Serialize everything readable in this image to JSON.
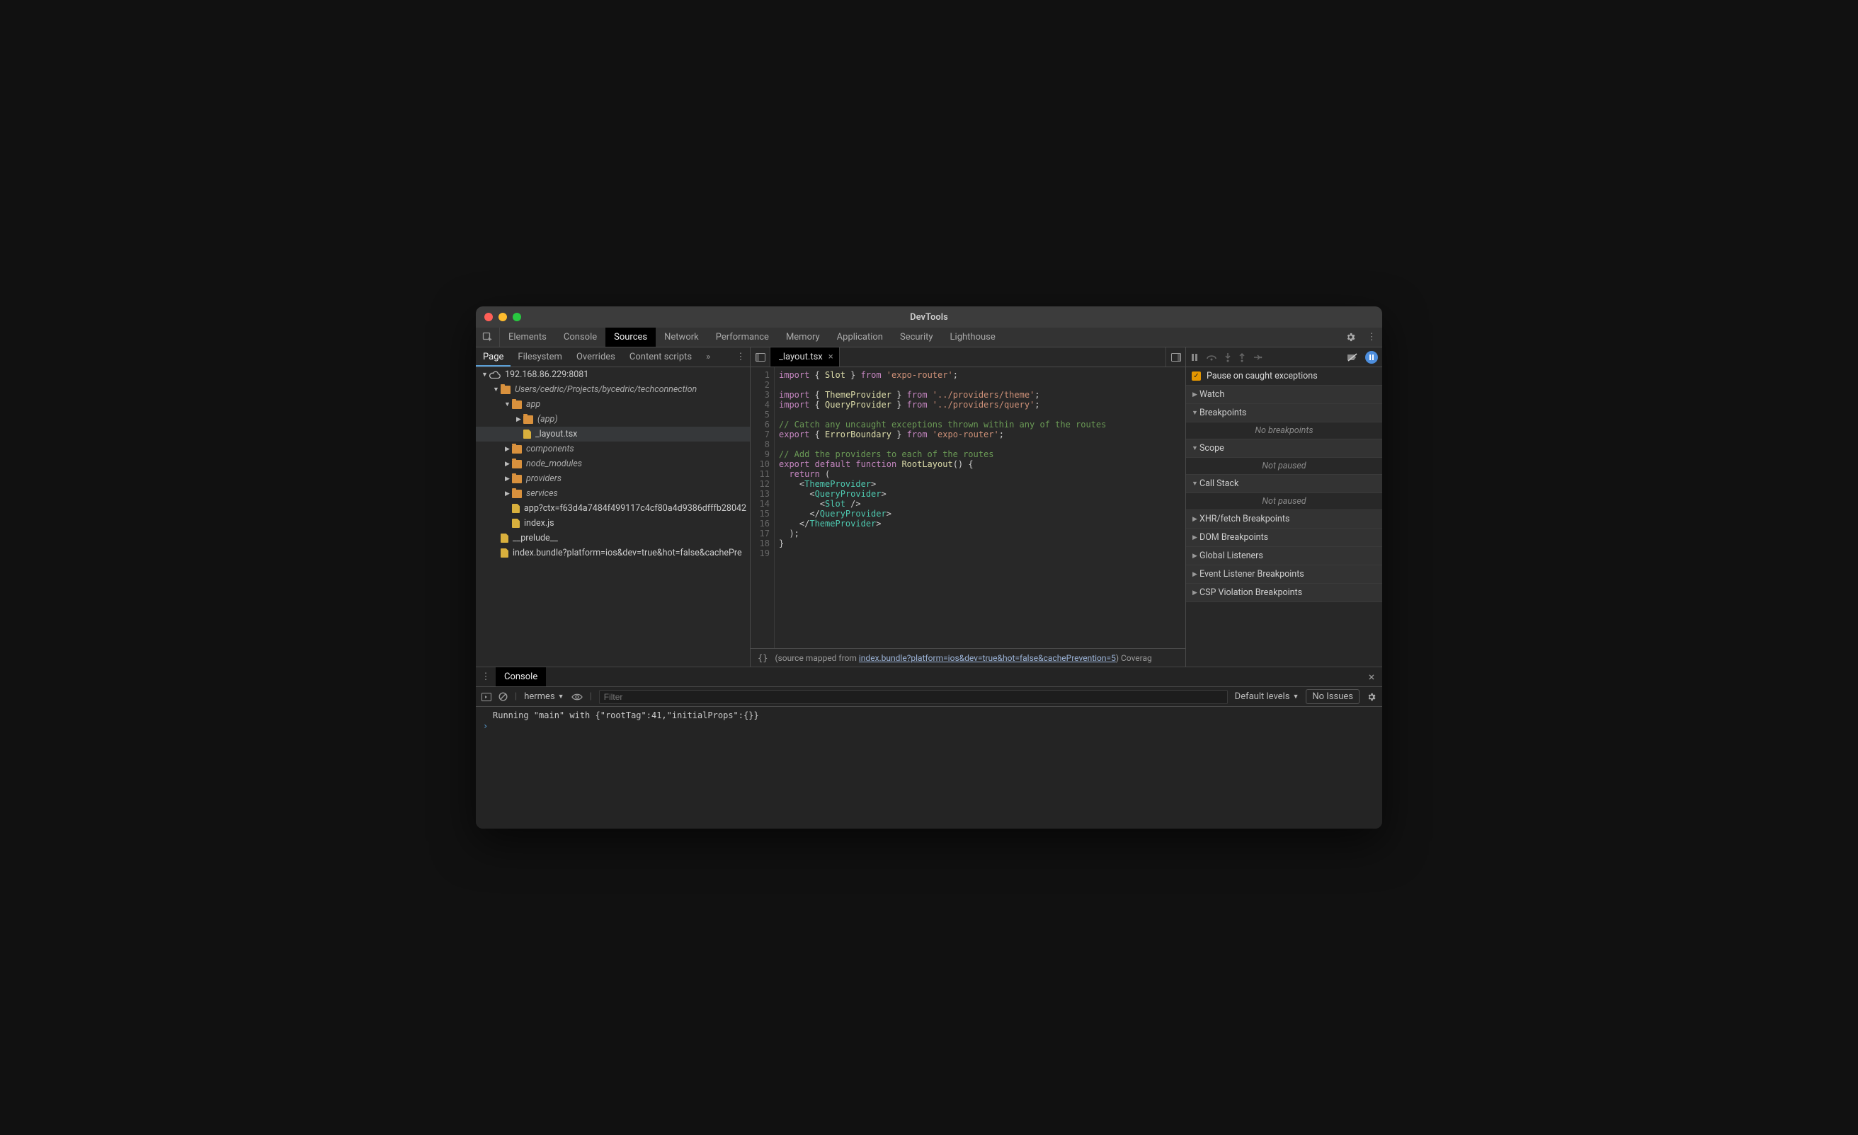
{
  "window": {
    "title": "DevTools"
  },
  "mainTabs": [
    "Elements",
    "Console",
    "Sources",
    "Network",
    "Performance",
    "Memory",
    "Application",
    "Security",
    "Lighthouse"
  ],
  "mainTabActive": "Sources",
  "navTabs": [
    "Page",
    "Filesystem",
    "Overrides",
    "Content scripts"
  ],
  "navTabActive": "Page",
  "tree": {
    "root": "192.168.86.229:8081",
    "rootPath": "Users/cedric/Projects/bycedric/techconnection",
    "app": "app",
    "appSub": "(app)",
    "selectedFile": "_layout.tsx",
    "folders": [
      "components",
      "node_modules",
      "providers",
      "services"
    ],
    "filesAfter": [
      "app?ctx=f63d4a7484f499117c4cf80a4d9386dfffb28042",
      "index.js"
    ],
    "prelude": "__prelude__",
    "bundle": "index.bundle?platform=ios&dev=true&hot=false&cachePre"
  },
  "editor": {
    "tab": "_layout.tsx",
    "lines": [
      [
        [
          "imp",
          "import"
        ],
        [
          "p",
          " { "
        ],
        [
          "id",
          "Slot"
        ],
        [
          "p",
          " } "
        ],
        [
          "imp",
          "from"
        ],
        [
          "p",
          " "
        ],
        [
          "str",
          "'expo-router'"
        ],
        [
          "p",
          ";"
        ]
      ],
      [],
      [
        [
          "imp",
          "import"
        ],
        [
          "p",
          " { "
        ],
        [
          "id",
          "ThemeProvider"
        ],
        [
          "p",
          " } "
        ],
        [
          "imp",
          "from"
        ],
        [
          "p",
          " "
        ],
        [
          "str",
          "'../providers/theme'"
        ],
        [
          "p",
          ";"
        ]
      ],
      [
        [
          "imp",
          "import"
        ],
        [
          "p",
          " { "
        ],
        [
          "id",
          "QueryProvider"
        ],
        [
          "p",
          " } "
        ],
        [
          "imp",
          "from"
        ],
        [
          "p",
          " "
        ],
        [
          "str",
          "'../providers/query'"
        ],
        [
          "p",
          ";"
        ]
      ],
      [],
      [
        [
          "cmt",
          "// Catch any uncaught exceptions thrown within any of the routes"
        ]
      ],
      [
        [
          "imp",
          "export"
        ],
        [
          "p",
          " { "
        ],
        [
          "id",
          "ErrorBoundary"
        ],
        [
          "p",
          " } "
        ],
        [
          "imp",
          "from"
        ],
        [
          "p",
          " "
        ],
        [
          "str",
          "'expo-router'"
        ],
        [
          "p",
          ";"
        ]
      ],
      [],
      [
        [
          "cmt",
          "// Add the providers to each of the routes"
        ]
      ],
      [
        [
          "imp",
          "export"
        ],
        [
          "p",
          " "
        ],
        [
          "imp",
          "default"
        ],
        [
          "p",
          " "
        ],
        [
          "imp",
          "function"
        ],
        [
          "p",
          " "
        ],
        [
          "id",
          "RootLayout"
        ],
        [
          "p",
          "() {"
        ]
      ],
      [
        [
          "p",
          "  "
        ],
        [
          "imp",
          "return"
        ],
        [
          "p",
          " ("
        ]
      ],
      [
        [
          "p",
          "    <"
        ],
        [
          "jsx",
          "ThemeProvider"
        ],
        [
          "p",
          ">"
        ]
      ],
      [
        [
          "p",
          "      <"
        ],
        [
          "jsx",
          "QueryProvider"
        ],
        [
          "p",
          ">"
        ]
      ],
      [
        [
          "p",
          "        <"
        ],
        [
          "jsx",
          "Slot"
        ],
        [
          "p",
          " />"
        ]
      ],
      [
        [
          "p",
          "      </"
        ],
        [
          "jsx",
          "QueryProvider"
        ],
        [
          "p",
          ">"
        ]
      ],
      [
        [
          "p",
          "    </"
        ],
        [
          "jsx",
          "ThemeProvider"
        ],
        [
          "p",
          ">"
        ]
      ],
      [
        [
          "p",
          "  );"
        ]
      ],
      [
        [
          "p",
          "}"
        ]
      ],
      []
    ],
    "statusPrefix": "(source mapped from ",
    "statusLink": "index.bundle?platform=ios&dev=true&hot=false&cachePrevention=5",
    "statusSuffix": ")  Coverag"
  },
  "debugger": {
    "pauseCaught": "Pause on caught exceptions",
    "sections": {
      "watch": "Watch",
      "breakpoints": "Breakpoints",
      "breakpointsBody": "No breakpoints",
      "scope": "Scope",
      "scopeBody": "Not paused",
      "callStack": "Call Stack",
      "callStackBody": "Not paused",
      "xhr": "XHR/fetch Breakpoints",
      "dom": "DOM Breakpoints",
      "global": "Global Listeners",
      "event": "Event Listener Breakpoints",
      "csp": "CSP Violation Breakpoints"
    }
  },
  "console": {
    "tab": "Console",
    "context": "hermes",
    "filterPlaceholder": "Filter",
    "levels": "Default levels",
    "issues": "No Issues",
    "line": "Running \"main\" with {\"rootTag\":41,\"initialProps\":{}}"
  }
}
